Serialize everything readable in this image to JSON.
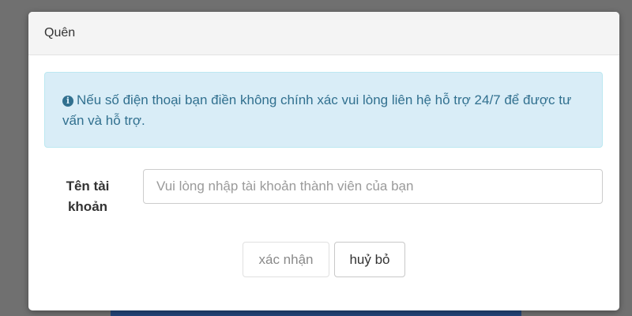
{
  "modal": {
    "title": "Quên"
  },
  "alert": {
    "icon": "info-circle-icon",
    "icon_glyph": "i",
    "text": "Nếu số điện thoại bạn điền không chính xác vui lòng liên hệ hỗ trợ 24/7 để được tư vấn và hỗ trợ."
  },
  "form": {
    "username_label": "Tên tài khoản",
    "username_value": "",
    "username_placeholder": "Vui lòng nhập tài khoản thành viên của bạn"
  },
  "buttons": {
    "confirm_label": "xác nhận",
    "cancel_label": "huỷ bỏ"
  },
  "colors": {
    "overlay": "#707070",
    "alert_background": "#d9edf7",
    "alert_text": "#31708f"
  }
}
